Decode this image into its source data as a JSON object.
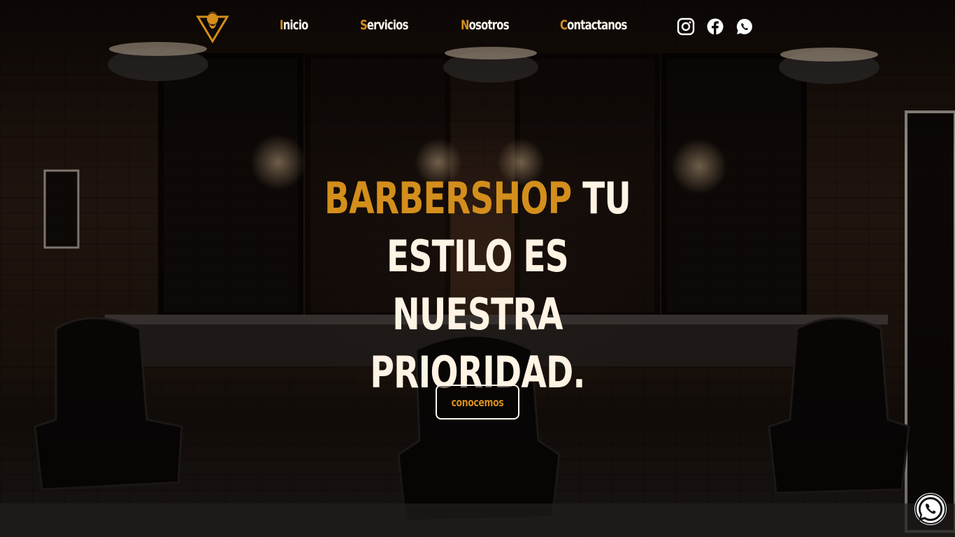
{
  "nav": {
    "links": [
      {
        "initial": "I",
        "rest": "nicio"
      },
      {
        "initial": "S",
        "rest": "ervicios"
      },
      {
        "initial": "N",
        "rest": "osotros"
      },
      {
        "initial": "C",
        "rest": "ontactanos"
      }
    ],
    "social_icons": [
      "instagram-icon",
      "facebook-icon",
      "whatsapp-icon"
    ]
  },
  "hero": {
    "title_accent": "BARBERSHOP",
    "title_rest": " TU ESTILO ES NUESTRA PRIORIDAD.",
    "button_label": "conocemos"
  },
  "colors": {
    "accent": "#d38e1c",
    "text": "#fff7ec",
    "background": "#1a100b"
  }
}
